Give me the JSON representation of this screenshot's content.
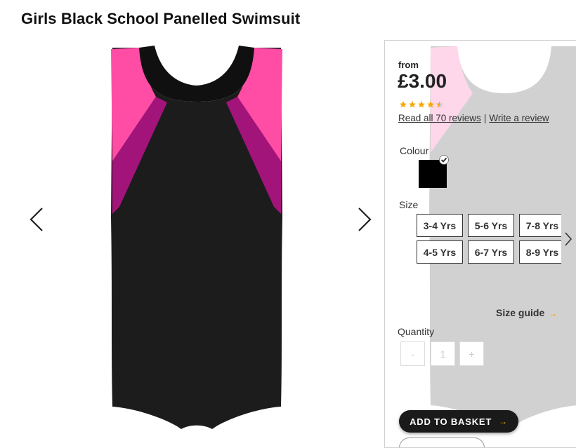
{
  "product": {
    "title": "Girls Black School Panelled Swimsuit"
  },
  "price": {
    "from_label": "from",
    "amount": "£3.00"
  },
  "rating": {
    "value": 4.5,
    "max": 5
  },
  "reviews": {
    "read_label": "Read all 70 reviews",
    "separator": "|",
    "write_label": "Write a review"
  },
  "colour": {
    "label": "Colour",
    "selected": "#000000"
  },
  "size": {
    "label": "Size",
    "options": [
      "3-4 Yrs",
      "5-6 Yrs",
      "7-8 Yrs",
      "4-5 Yrs",
      "6-7 Yrs",
      "8-9 Yrs"
    ],
    "guide_label": "Size guide",
    "guide_arrow": "→"
  },
  "quantity": {
    "label": "Quantity",
    "minus": "-",
    "value": "1",
    "plus": "+"
  },
  "basket": {
    "label": "ADD TO BASKET",
    "arrow": "→"
  },
  "colors": {
    "accent": "#e8a000",
    "pink": "#ff4da6",
    "magenta": "#a3147a",
    "black": "#1a1a1a"
  },
  "icons": [
    "chevron-left-icon",
    "chevron-right-icon",
    "star-icon",
    "check-icon",
    "arrow-right-icon"
  ]
}
